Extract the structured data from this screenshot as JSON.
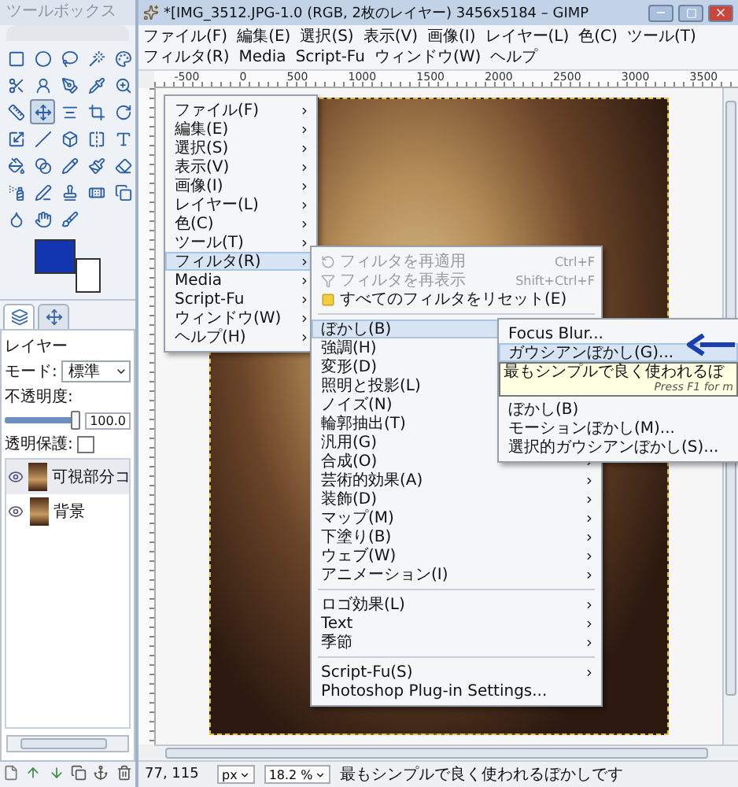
{
  "toolbox": {
    "title": "ツールボックス",
    "tools": [
      {
        "selected": false
      },
      {
        "selected": false
      },
      {
        "selected": false
      },
      {
        "selected": false
      },
      {
        "selected": false
      },
      {
        "selected": false
      },
      {
        "selected": false
      },
      {
        "selected": false
      },
      {
        "selected": false
      },
      {
        "selected": false
      },
      {
        "selected": false
      },
      {
        "selected": true
      },
      {
        "selected": false
      },
      {
        "selected": false
      },
      {
        "selected": false
      },
      {
        "selected": false
      },
      {
        "selected": false
      },
      {
        "selected": false
      },
      {
        "selected": false
      },
      {
        "selected": false
      },
      {
        "selected": false
      },
      {
        "selected": false
      },
      {
        "selected": false
      },
      {
        "selected": false
      },
      {
        "selected": false
      },
      {
        "selected": false
      },
      {
        "selected": false
      },
      {
        "selected": false
      },
      {
        "selected": false
      },
      {
        "selected": false
      },
      {
        "selected": false
      },
      {
        "selected": false
      },
      {
        "selected": false
      }
    ],
    "colors": [
      {
        "kind": "foreground",
        "color": "#1236b0"
      },
      {
        "kind": "background",
        "color": "#ffffff"
      }
    ]
  },
  "layers_panel": {
    "tabs": [
      {
        "selected": true
      },
      {
        "selected": false
      }
    ],
    "title": "レイヤー",
    "mode_label": "モード:",
    "mode_value": "標準",
    "opacity_label": "不透明度:",
    "opacity": {
      "level": 1,
      "reading": "100.0"
    },
    "lock_label": "透明保護:",
    "lock_alpha": {
      "checked": false
    },
    "layers": [
      {
        "name": "可視部分コ",
        "visible": true,
        "selected": true
      },
      {
        "name": "背景",
        "visible": true,
        "selected": false
      }
    ]
  },
  "window": {
    "title": "*[IMG_3512.JPG-1.0 (RGB, 2枚のレイヤー) 3456x5184 – GIMP",
    "menu": [
      "ファイル(F)",
      "編集(E)",
      "選択(S)",
      "表示(V)",
      "画像(I)",
      "レイヤー(L)",
      "色(C)",
      "ツール(T)",
      "フィルタ(R)",
      "Media",
      "Script-Fu",
      "ウィンドウ(W)",
      "ヘルプ"
    ],
    "ruler_ticks": [
      "-500",
      "0",
      "500",
      "1000",
      "1500",
      "2000",
      "2500",
      "3000",
      "3500"
    ]
  },
  "context_menu": {
    "items": [
      {
        "label": "ファイル(F)",
        "selected": false
      },
      {
        "label": "編集(E)",
        "selected": false
      },
      {
        "label": "選択(S)",
        "selected": false
      },
      {
        "label": "表示(V)",
        "selected": false
      },
      {
        "label": "画像(I)",
        "selected": false
      },
      {
        "label": "レイヤー(L)",
        "selected": false
      },
      {
        "label": "色(C)",
        "selected": false
      },
      {
        "label": "ツール(T)",
        "selected": false
      },
      {
        "label": "フィルタ(R)",
        "selected": true
      },
      {
        "label": "Media",
        "selected": false
      },
      {
        "label": "Script-Fu",
        "selected": false
      },
      {
        "label": "ウィンドウ(W)",
        "selected": false
      },
      {
        "label": "ヘルプ(H)",
        "selected": false
      }
    ]
  },
  "filters_menu": {
    "items": [
      {
        "kind": "command",
        "label": "フィルタを再適用",
        "shortcut": "Ctrl+F",
        "disabled": true,
        "selected": false
      },
      {
        "kind": "command",
        "label": "フィルタを再表示",
        "shortcut": "Shift+Ctrl+F",
        "disabled": true,
        "selected": false
      },
      {
        "kind": "command",
        "label": "すべてのフィルタをリセット(E)",
        "disabled": false,
        "selected": false
      },
      {
        "kind": "separator"
      },
      {
        "kind": "submenu",
        "label": "ぼかし(B)",
        "selected": true
      },
      {
        "kind": "submenu",
        "label": "強調(H)",
        "selected": false
      },
      {
        "kind": "submenu",
        "label": "変形(D)",
        "selected": false
      },
      {
        "kind": "submenu",
        "label": "照明と投影(L)",
        "selected": false
      },
      {
        "kind": "submenu",
        "label": "ノイズ(N)",
        "selected": false
      },
      {
        "kind": "submenu",
        "label": "輪郭抽出(T)",
        "selected": false
      },
      {
        "kind": "submenu",
        "label": "汎用(G)",
        "selected": false
      },
      {
        "kind": "submenu",
        "label": "合成(O)",
        "selected": false
      },
      {
        "kind": "submenu",
        "label": "芸術的効果(A)",
        "selected": false
      },
      {
        "kind": "submenu",
        "label": "装飾(D)",
        "selected": false
      },
      {
        "kind": "submenu",
        "label": "マップ(M)",
        "selected": false
      },
      {
        "kind": "submenu",
        "label": "下塗り(B)",
        "selected": false
      },
      {
        "kind": "submenu",
        "label": "ウェブ(W)",
        "selected": false
      },
      {
        "kind": "submenu",
        "label": "アニメーション(I)",
        "selected": false
      },
      {
        "kind": "separator"
      },
      {
        "kind": "submenu",
        "label": "ロゴ効果(L)",
        "selected": false
      },
      {
        "kind": "submenu",
        "label": "Text",
        "selected": false
      },
      {
        "kind": "submenu",
        "label": "季節",
        "selected": false
      },
      {
        "kind": "separator"
      },
      {
        "kind": "submenu",
        "label": "Script-Fu(S)",
        "selected": false
      },
      {
        "kind": "action",
        "label": "Photoshop Plug-in Settings...",
        "selected": false
      }
    ]
  },
  "blur_menu": {
    "items": [
      {
        "label": "Focus Blur...",
        "selected": false
      },
      {
        "label": "ガウシアンぼかし(G)...",
        "selected": true
      },
      {
        "label": "ぼかし(B)",
        "selected": false
      },
      {
        "label": "モーションぼかし(M)...",
        "selected": false
      },
      {
        "label": "選択的ガウシアンぼかし(S)...",
        "selected": false
      }
    ]
  },
  "tooltip": {
    "text": "最もシンプルで良く使われるぼ",
    "hint": "Press F1 for m"
  },
  "status_bar": {
    "coordinates": "77, 115",
    "unit": "px",
    "zoom": "18.2 %",
    "message": "最もシンプルで良く使われるぼかしです"
  }
}
